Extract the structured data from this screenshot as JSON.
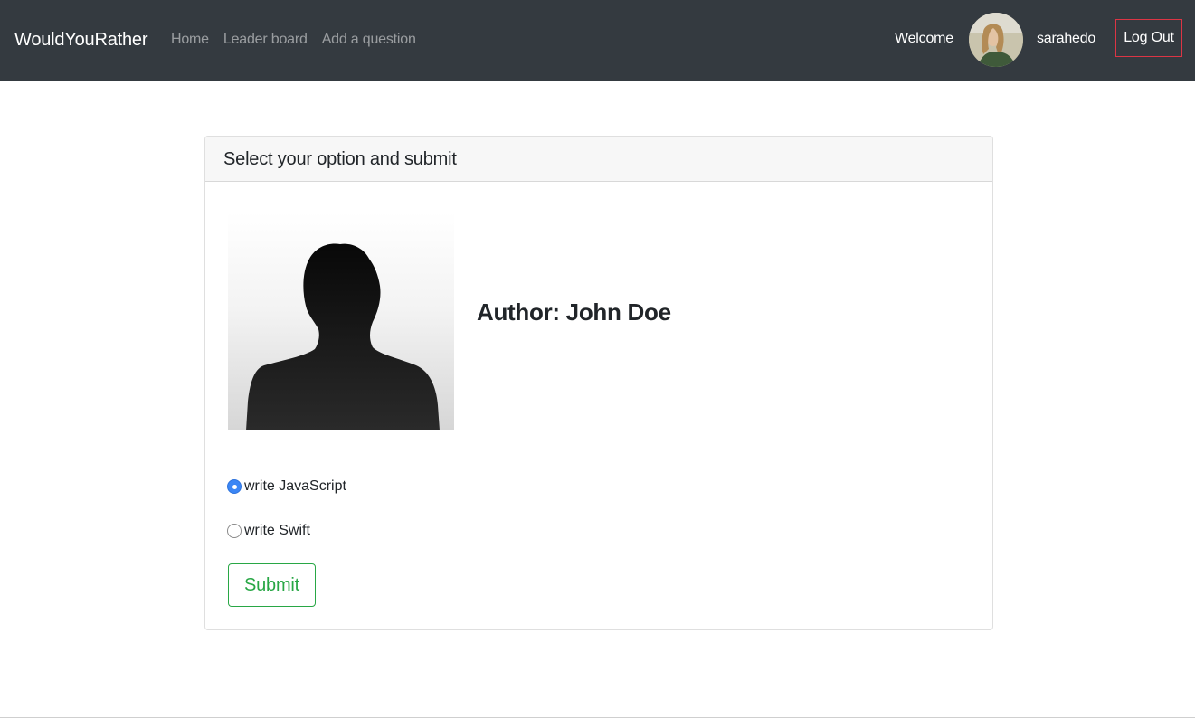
{
  "navbar": {
    "brand": "WouldYouRather",
    "links": [
      {
        "label": "Home"
      },
      {
        "label": "Leader board"
      },
      {
        "label": "Add a question"
      }
    ],
    "welcome": "Welcome",
    "username": "sarahedo",
    "logout_label": "Log Out",
    "avatar_icon": "user-photo"
  },
  "card": {
    "header": "Select your option and submit",
    "author_label": "Author: John Doe",
    "author_image_icon": "person-silhouette",
    "options": [
      {
        "label": "write JavaScript",
        "selected": true
      },
      {
        "label": "write Swift",
        "selected": false
      }
    ],
    "submit_label": "Submit"
  },
  "colors": {
    "navbar_bg": "#343a40",
    "logout_border": "#dc3545",
    "submit": "#28a745",
    "radio_checked": "#3b86f5"
  }
}
